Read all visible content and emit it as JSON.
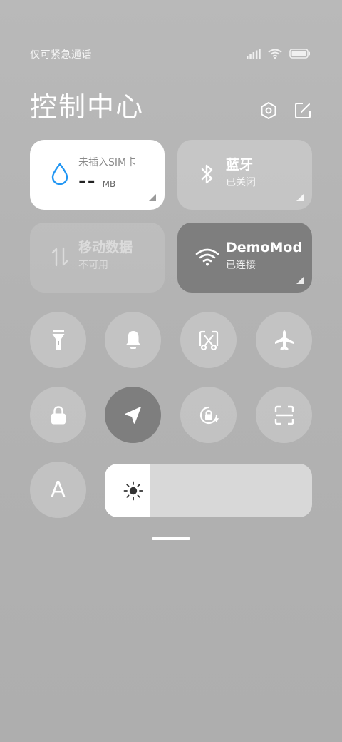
{
  "status_bar": {
    "carrier_text": "仅可紧急通话",
    "icons": [
      "signal-icon",
      "wifi-icon",
      "battery-icon"
    ]
  },
  "header": {
    "title": "控制中心",
    "actions": [
      "settings-icon",
      "edit-icon"
    ]
  },
  "tiles": {
    "data_usage": {
      "label": "未插入SIM卡",
      "value": "--",
      "unit": "MB",
      "icon": "water-drop-icon"
    },
    "bluetooth": {
      "title": "蓝牙",
      "status": "已关闭",
      "icon": "bluetooth-icon"
    },
    "mobile_data": {
      "title": "移动数据",
      "status": "不可用",
      "icon": "data-arrows-icon"
    },
    "wifi": {
      "title": "DemoMode",
      "status": "已连接",
      "icon": "wifi-icon"
    }
  },
  "toggles": [
    {
      "name": "flashlight",
      "icon": "flashlight-icon",
      "active": false
    },
    {
      "name": "mute",
      "icon": "bell-icon",
      "active": false
    },
    {
      "name": "screenshot",
      "icon": "scissors-icon",
      "active": false
    },
    {
      "name": "airplane-mode",
      "icon": "airplane-icon",
      "active": false
    },
    {
      "name": "lock-screen",
      "icon": "lock-icon",
      "active": false
    },
    {
      "name": "location",
      "icon": "location-arrow-icon",
      "active": true
    },
    {
      "name": "rotation-lock",
      "icon": "rotation-lock-icon",
      "active": false
    },
    {
      "name": "scanner",
      "icon": "scan-icon",
      "active": false
    },
    {
      "name": "auto-brightness",
      "icon": "auto-brightness-icon",
      "active": false
    }
  ],
  "auto_brightness_label": "A",
  "brightness": {
    "level": 0.22,
    "icon": "sun-icon"
  },
  "colors": {
    "background": "#b5b5b5",
    "active": "#7e7e7e",
    "accent_blue": "#2196f3"
  }
}
